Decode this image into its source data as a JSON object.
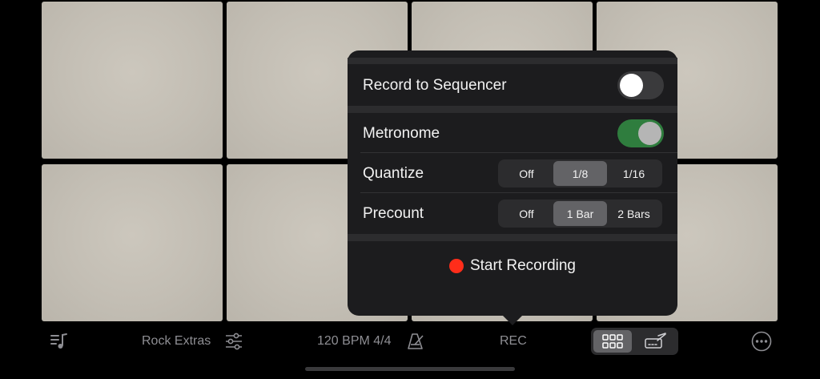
{
  "popover": {
    "record_to_sequencer": {
      "label": "Record to Sequencer",
      "enabled": false
    },
    "metronome": {
      "label": "Metronome",
      "enabled": true
    },
    "quantize": {
      "label": "Quantize",
      "options": [
        "Off",
        "1/8",
        "1/16"
      ],
      "selected": "1/8"
    },
    "precount": {
      "label": "Precount",
      "options": [
        "Off",
        "1 Bar",
        "2 Bars"
      ],
      "selected": "1 Bar"
    },
    "start_recording_label": "Start Recording"
  },
  "toolbar": {
    "kit_name": "Rock Extras",
    "tempo": "120 BPM 4/4",
    "rec_label": "REC"
  },
  "colors": {
    "pad": "#c3beb4",
    "popover_bg": "#1c1c1e",
    "switch_on": "#2f7d3e",
    "record_dot": "#ff2d1a",
    "toolbar_text": "#8e8e93"
  },
  "icons": {
    "browser": "music-list-icon",
    "kit_settings": "sliders-icon",
    "metronome": "metronome-icon",
    "grid_view": "grid-icon",
    "edit_view": "pencil-sequencer-icon",
    "more": "ellipsis-circle-icon"
  }
}
